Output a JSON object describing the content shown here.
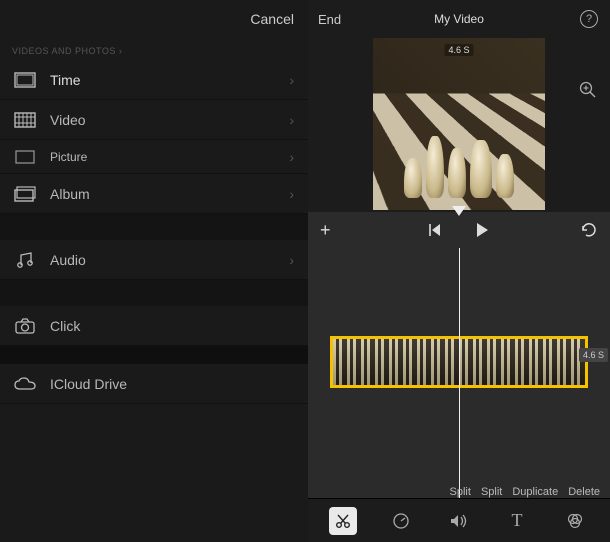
{
  "leftPanel": {
    "cancel": "Cancel",
    "sectionHeader": "VIDEOS AND PHOTOS ›",
    "items": [
      {
        "label": "Time"
      },
      {
        "label": "Video"
      },
      {
        "label": "Picture"
      },
      {
        "label": "Album"
      }
    ],
    "audio": {
      "label": "Audio"
    },
    "click": {
      "label": "Click"
    },
    "icloud": {
      "label": "ICloud Drive"
    }
  },
  "editor": {
    "end": "End",
    "title": "My Video",
    "previewDuration": "4.6 S",
    "clipDuration": "4.6 S",
    "actions": {
      "split1": "Split",
      "split2": "Split",
      "duplicate": "Duplicate",
      "delete": "Delete"
    }
  }
}
